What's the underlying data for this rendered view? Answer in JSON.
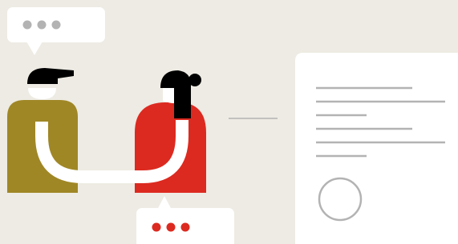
{
  "illustration": {
    "subject": "handshake-agreement",
    "colors": {
      "background": "#edebe3",
      "card": "#ffffff",
      "person_left_body": "#a08726",
      "person_right_body": "#dc2a20",
      "hair": "#000000",
      "skin_and_arm": "#ffffff",
      "typing_dots_gray": "#b3b3b3",
      "typing_dots_red": "#dc2a20",
      "document_lines": "#b3b3b3",
      "seal_circle": "#b3b3b3",
      "connector_line": "#b3b3b3"
    },
    "icons": {
      "speech_bubble_left": "speech-bubble-icon",
      "speech_bubble_right": "speech-bubble-icon",
      "document": "document-icon",
      "signature_seal": "seal-circle-icon"
    }
  }
}
